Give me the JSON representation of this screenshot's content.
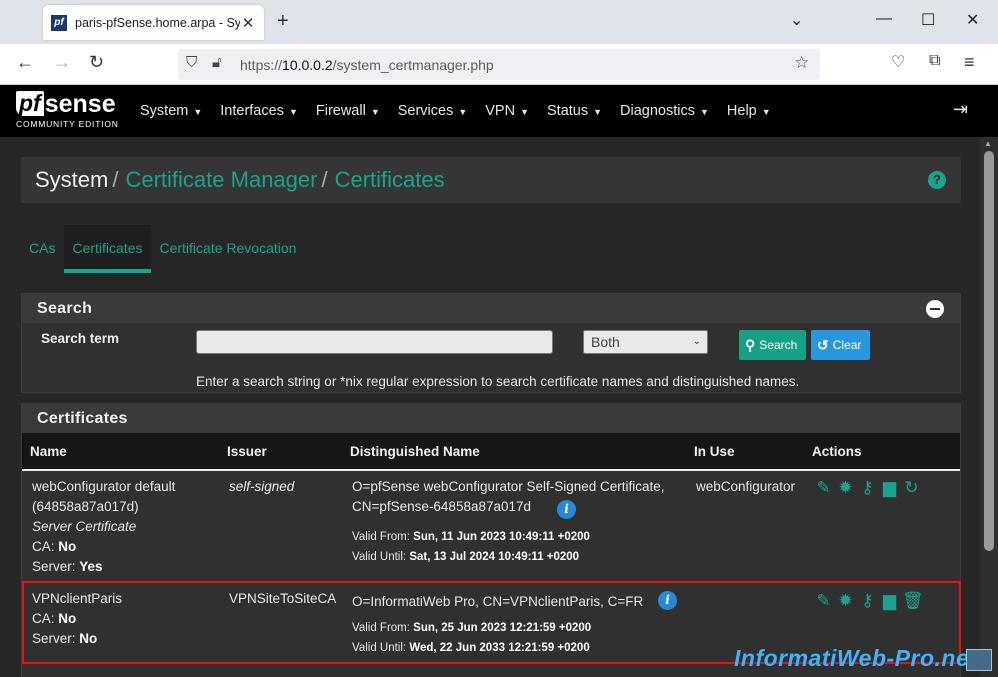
{
  "browser": {
    "tab_title": "paris-pfSense.home.arpa - System",
    "favicon_text": "pf",
    "url_protocol": "https://",
    "url_host": "10.0.0.2",
    "url_path": "/system_certmanager.php"
  },
  "brand": {
    "logo_pf": "pf",
    "logo_sense": "sense",
    "logo_sub": "COMMUNITY EDITION"
  },
  "nav": {
    "items": [
      "System",
      "Interfaces",
      "Firewall",
      "Services",
      "VPN",
      "Status",
      "Diagnostics",
      "Help"
    ]
  },
  "breadcrumb": {
    "root": "System",
    "sep": "/",
    "level1": "Certificate Manager",
    "level2": "Certificates"
  },
  "tabs": [
    {
      "label": "CAs",
      "active": false
    },
    {
      "label": "Certificates",
      "active": true
    },
    {
      "label": "Certificate Revocation",
      "active": false
    }
  ],
  "search_panel": {
    "title": "Search",
    "term_label": "Search term",
    "term_value": "",
    "scope_selected": "Both",
    "search_button": "Search",
    "clear_button": "Clear",
    "help_text": "Enter a search string or *nix regular expression to search certificate names and distinguished names."
  },
  "cert_panel": {
    "title": "Certificates",
    "columns": [
      "Name",
      "Issuer",
      "Distinguished Name",
      "In Use",
      "Actions"
    ],
    "rows": [
      {
        "name_line1": "webConfigurator default",
        "name_line2": "(64858a87a017d)",
        "type": "Server Certificate",
        "ca_label": "CA:",
        "ca_value": "No",
        "server_label": "Server:",
        "server_value": "Yes",
        "issuer": "self-signed",
        "dn_line1": "O=pfSense webConfigurator Self-Signed Certificate,",
        "dn_line2": "CN=pfSense-64858a87a017d",
        "valid_from_label": "Valid From:",
        "valid_from": "Sun, 11 Jun 2023 10:49:11 +0200",
        "valid_until_label": "Valid Until:",
        "valid_until": "Sat, 13 Jul 2024 10:49:11 +0200",
        "in_use": "webConfigurator"
      },
      {
        "name_line1": "VPNclientParis",
        "ca_label": "CA:",
        "ca_value": "No",
        "server_label": "Server:",
        "server_value": "No",
        "issuer": "VPNSiteToSiteCA",
        "dn_line1": "O=InformatiWeb Pro, CN=VPNclientParis, C=FR",
        "valid_from_label": "Valid From:",
        "valid_from": "Sun, 25 Jun 2023 12:21:59 +0200",
        "valid_until_label": "Valid Until:",
        "valid_until": "Wed, 22 Jun 2033 12:21:59 +0200",
        "in_use": ""
      }
    ]
  },
  "watermark": "InformatiWeb-Pro.net",
  "colors": {
    "accent": "#1aa38e",
    "info": "#2a86d6",
    "highlight": "#e51414",
    "background": "#272727"
  }
}
